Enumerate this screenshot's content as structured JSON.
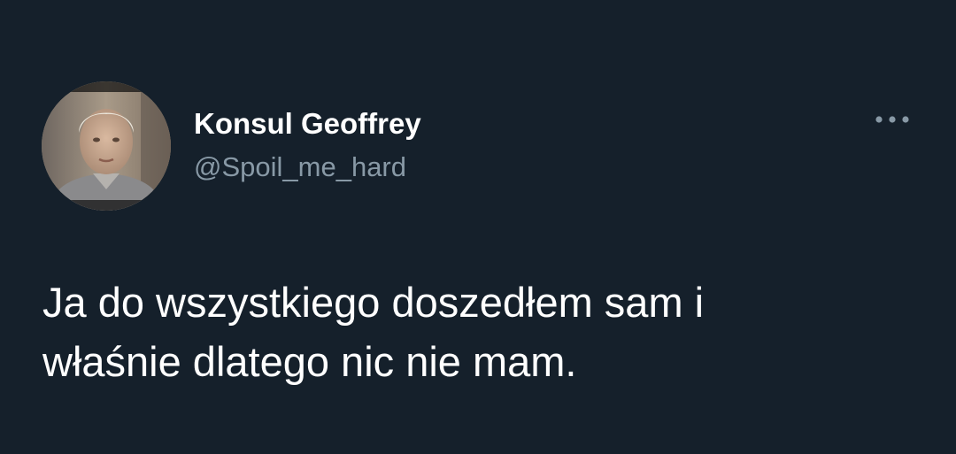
{
  "tweet": {
    "author": {
      "display_name": "Konsul Geoffrey",
      "handle": "@Spoil_me_hard"
    },
    "text_lines": [
      "Ja do wszystkiego doszedłem sam i",
      "właśnie dlatego nic nie mam."
    ],
    "icons": {
      "avatar": "profile-photo",
      "more": "more-options-icon"
    }
  },
  "colors": {
    "background": "#15202b",
    "primary_text": "#ffffff",
    "secondary_text": "#8899a6"
  }
}
